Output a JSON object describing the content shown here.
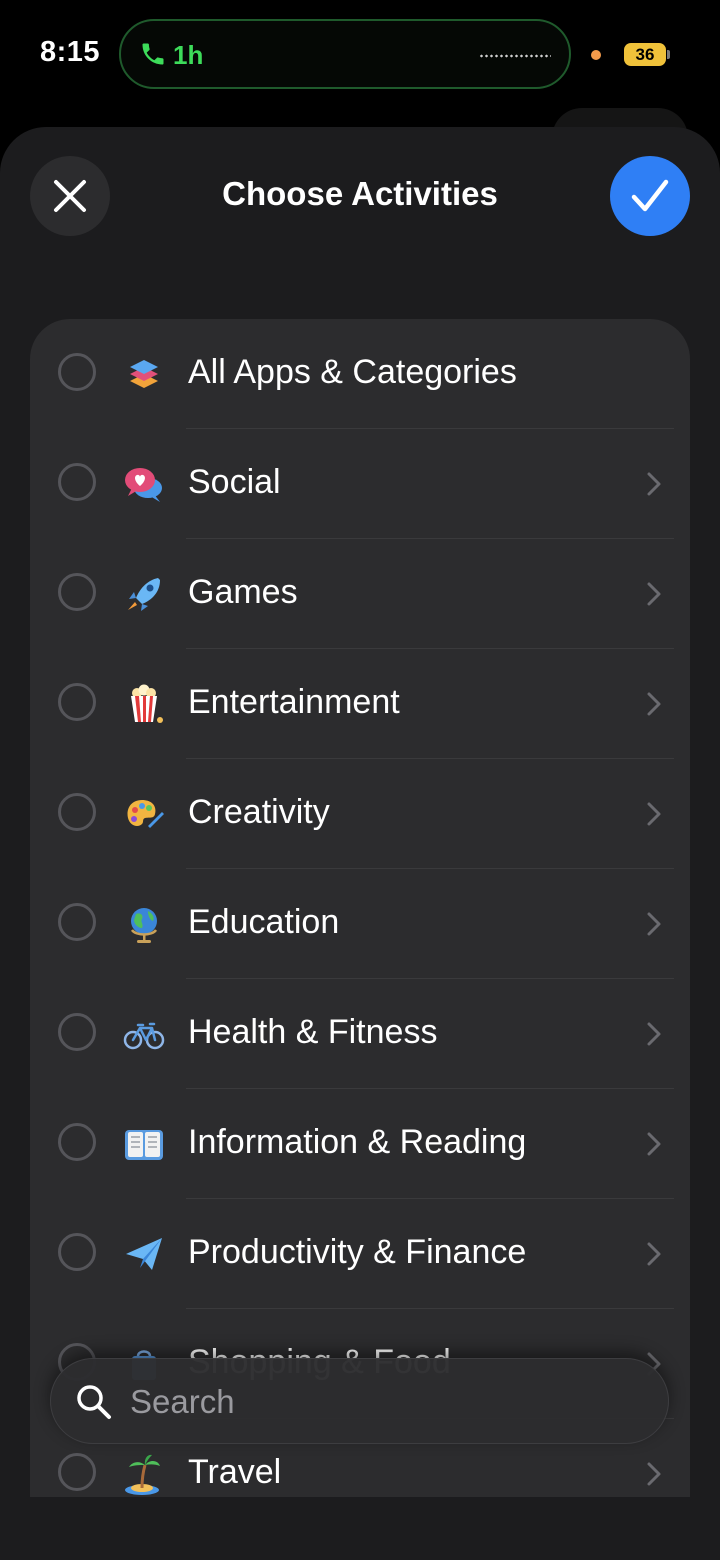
{
  "status_bar": {
    "time": "8:15",
    "call_duration": "1h",
    "battery": "36",
    "call_color": "#3ddc5a",
    "battery_color": "#f0c23a"
  },
  "header": {
    "title": "Choose Activities",
    "close_icon": "close-icon",
    "done_icon": "checkmark-icon",
    "accent_color": "#2f7ff5"
  },
  "activities": [
    {
      "label": "All Apps & Categories",
      "icon": "stack-icon",
      "has_chevron": false
    },
    {
      "label": "Social",
      "icon": "speech-bubble-heart-icon",
      "has_chevron": true
    },
    {
      "label": "Games",
      "icon": "rocket-icon",
      "has_chevron": true
    },
    {
      "label": "Entertainment",
      "icon": "popcorn-icon",
      "has_chevron": true
    },
    {
      "label": "Creativity",
      "icon": "palette-icon",
      "has_chevron": true
    },
    {
      "label": "Education",
      "icon": "globe-icon",
      "has_chevron": true
    },
    {
      "label": "Health & Fitness",
      "icon": "bicycle-icon",
      "has_chevron": true
    },
    {
      "label": "Information & Reading",
      "icon": "book-icon",
      "has_chevron": true
    },
    {
      "label": "Productivity & Finance",
      "icon": "paper-plane-icon",
      "has_chevron": true
    },
    {
      "label": "Shopping & Food",
      "icon": "shopping-bag-icon",
      "has_chevron": true
    },
    {
      "label": "Travel",
      "icon": "palm-tree-icon",
      "has_chevron": true
    }
  ],
  "search": {
    "placeholder": "Search"
  }
}
